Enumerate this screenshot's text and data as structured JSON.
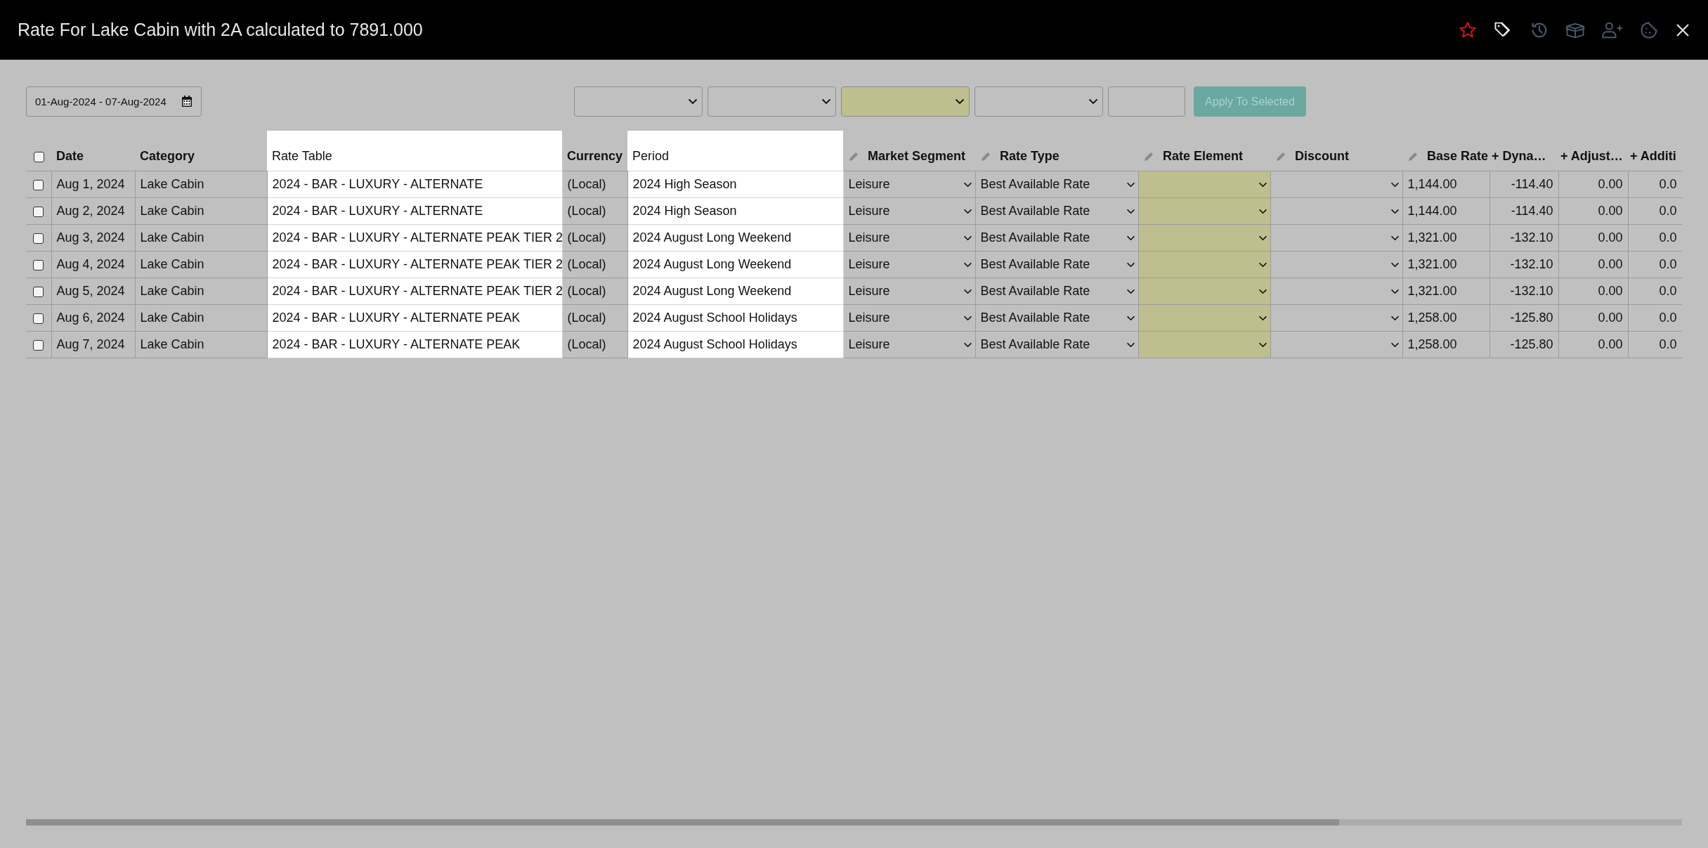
{
  "window": {
    "title": "Rate For Lake Cabin with 2A calculated to 7891.000",
    "favorite": true,
    "icons": [
      {
        "kind": "star"
      },
      {
        "kind": "tags"
      },
      {
        "kind": "history"
      },
      {
        "kind": "box"
      },
      {
        "kind": "add-user"
      },
      {
        "kind": "cookie"
      },
      {
        "kind": "close"
      }
    ]
  },
  "toolbar": {
    "date_range": "01-Aug-2024 - 07-Aug-2024",
    "fields": [
      {
        "kind": "dropdown"
      },
      {
        "kind": "dropdown"
      },
      {
        "kind": "flagged"
      },
      {
        "kind": "dropdown"
      },
      {
        "kind": "input"
      }
    ],
    "apply_button": {
      "label": "Apply To Selected",
      "disabled": true
    }
  },
  "table": {
    "all_checked": false,
    "columns": [
      {
        "label": "Date",
        "kind": "text",
        "editable": false
      },
      {
        "label": "Category",
        "kind": "text",
        "editable": false
      },
      {
        "label": "Rate Table",
        "kind": "highlight",
        "editable": false
      },
      {
        "label": "Currency",
        "kind": "text",
        "editable": false
      },
      {
        "label": "Period",
        "kind": "highlight",
        "editable": false
      },
      {
        "label": "Market Segment",
        "kind": "dropdown",
        "editable": true
      },
      {
        "label": "Rate Type",
        "kind": "dropdown",
        "editable": true
      },
      {
        "label": "Rate Element",
        "kind": "flagged",
        "editable": true
      },
      {
        "label": "Discount",
        "kind": "dropdown",
        "editable": true
      },
      {
        "label": "Base Rate",
        "kind": "text",
        "editable": true
      },
      {
        "label": "+ Dyna…",
        "kind": "amount",
        "editable": false
      },
      {
        "label": "+ Adjust…",
        "kind": "amount",
        "editable": false
      },
      {
        "label": "+ Additi",
        "kind": "amount",
        "editable": false
      }
    ],
    "rows": [
      {
        "checked": false,
        "cells": [
          "Aug 1, 2024",
          "Lake Cabin",
          "2024 - BAR - LUXURY - ALTERNATE",
          "(Local)",
          "2024 High Season",
          "Leisure",
          "Best Available Rate",
          null,
          null,
          "1,144.00",
          "-114.40",
          "0.00",
          "0.0"
        ]
      },
      {
        "checked": false,
        "cells": [
          "Aug 2, 2024",
          "Lake Cabin",
          "2024 - BAR - LUXURY - ALTERNATE",
          "(Local)",
          "2024 High Season",
          "Leisure",
          "Best Available Rate",
          null,
          null,
          "1,144.00",
          "-114.40",
          "0.00",
          "0.0"
        ]
      },
      {
        "checked": false,
        "cells": [
          "Aug 3, 2024",
          "Lake Cabin",
          "2024 - BAR - LUXURY - ALTERNATE PEAK TIER 2",
          "(Local)",
          "2024 August Long Weekend",
          "Leisure",
          "Best Available Rate",
          null,
          null,
          "1,321.00",
          "-132.10",
          "0.00",
          "0.0"
        ]
      },
      {
        "checked": false,
        "cells": [
          "Aug 4, 2024",
          "Lake Cabin",
          "2024 - BAR - LUXURY - ALTERNATE PEAK TIER 2",
          "(Local)",
          "2024 August Long Weekend",
          "Leisure",
          "Best Available Rate",
          null,
          null,
          "1,321.00",
          "-132.10",
          "0.00",
          "0.0"
        ]
      },
      {
        "checked": false,
        "cells": [
          "Aug 5, 2024",
          "Lake Cabin",
          "2024 - BAR - LUXURY - ALTERNATE PEAK TIER 2",
          "(Local)",
          "2024 August Long Weekend",
          "Leisure",
          "Best Available Rate",
          null,
          null,
          "1,321.00",
          "-132.10",
          "0.00",
          "0.0"
        ]
      },
      {
        "checked": false,
        "cells": [
          "Aug 6, 2024",
          "Lake Cabin",
          "2024 - BAR - LUXURY - ALTERNATE PEAK",
          "(Local)",
          "2024 August School Holidays",
          "Leisure",
          "Best Available Rate",
          null,
          null,
          "1,258.00",
          "-125.80",
          "0.00",
          "0.0"
        ]
      },
      {
        "checked": false,
        "cells": [
          "Aug 7, 2024",
          "Lake Cabin",
          "2024 - BAR - LUXURY - ALTERNATE PEAK",
          "(Local)",
          "2024 August School Holidays",
          "Leisure",
          "Best Available Rate",
          null,
          null,
          "1,258.00",
          "-125.80",
          "0.00",
          "0.0"
        ]
      }
    ]
  }
}
